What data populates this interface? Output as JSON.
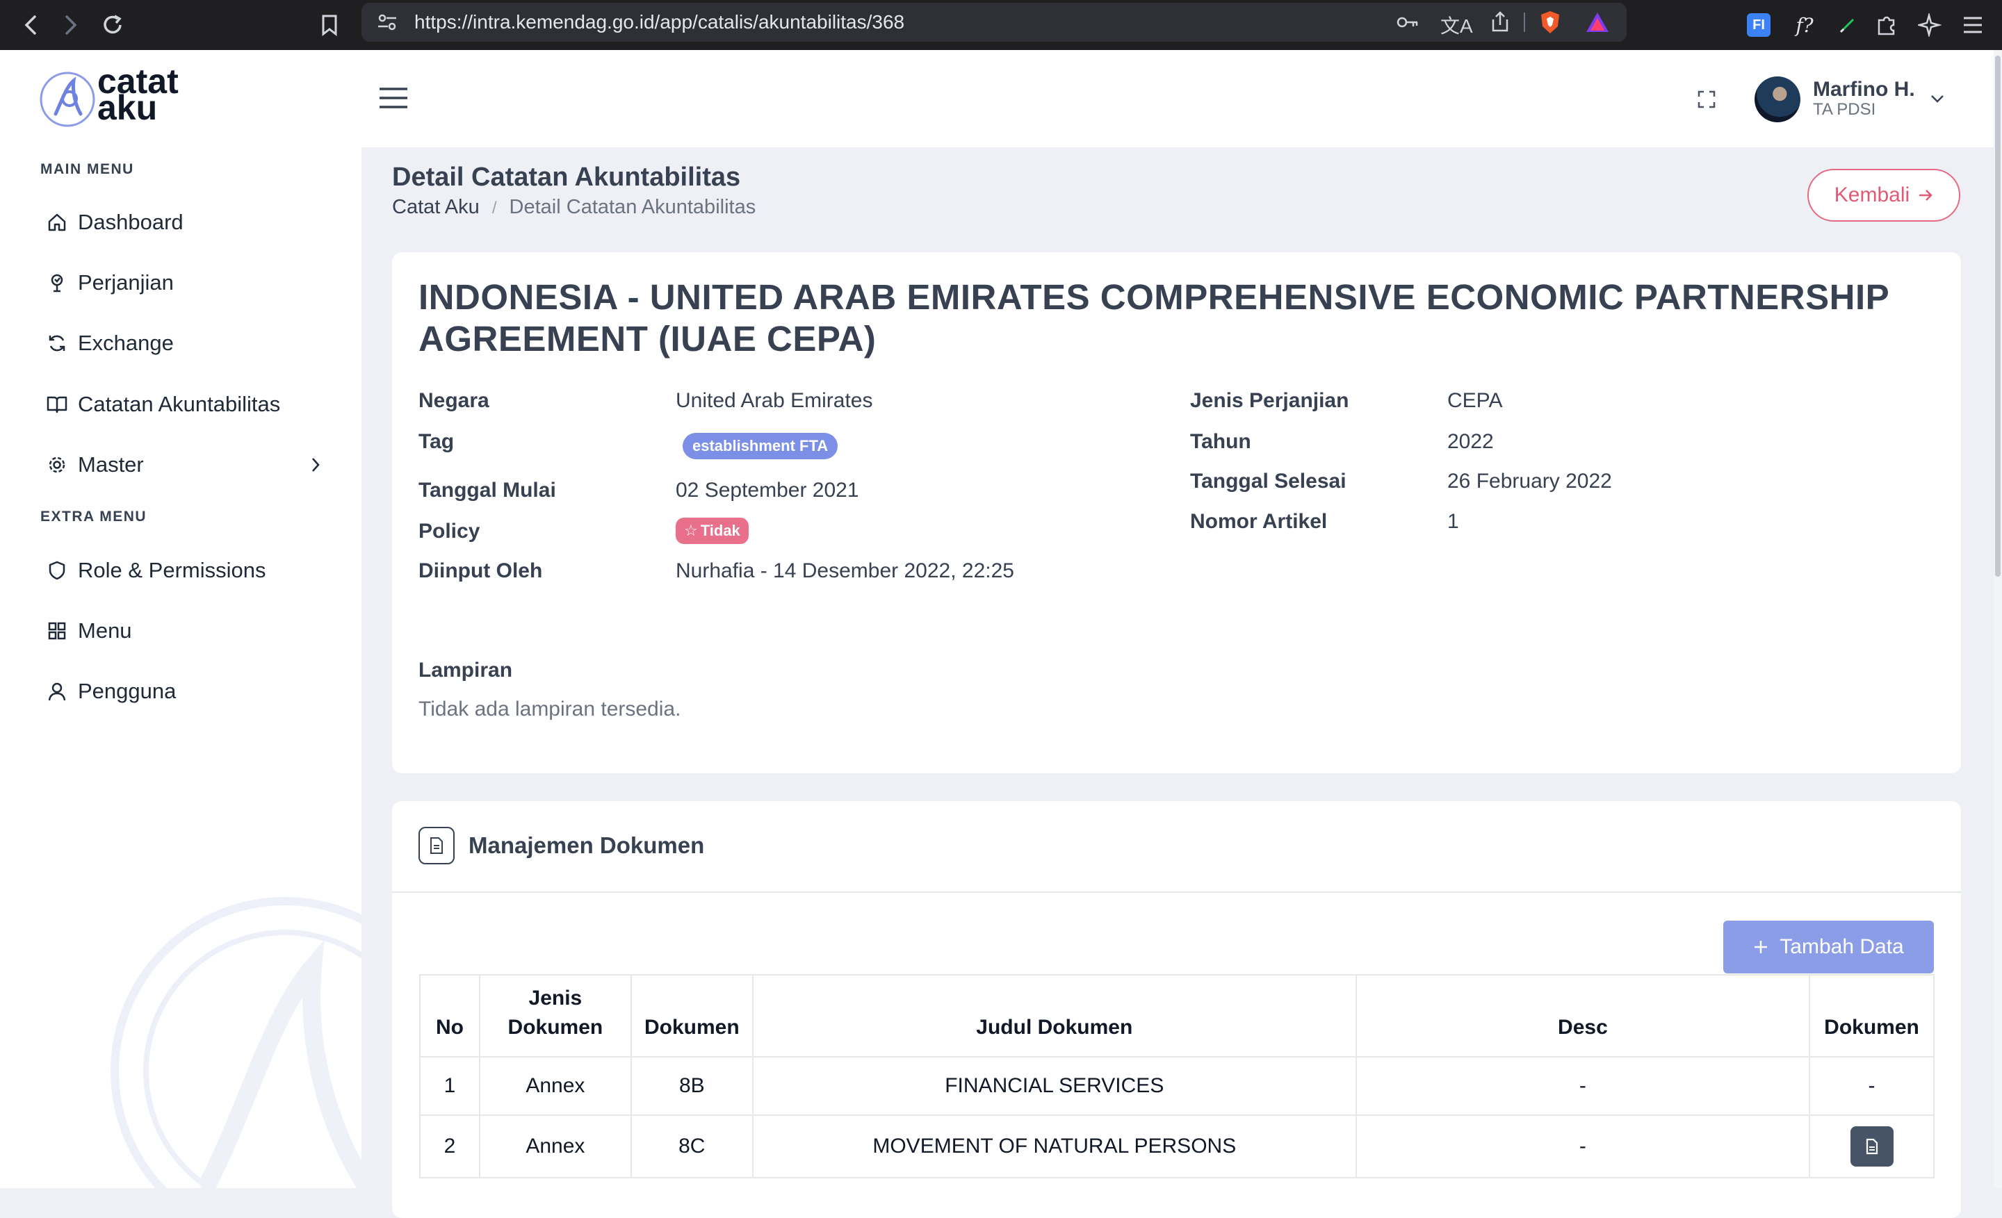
{
  "browser": {
    "url": "https://intra.kemendag.go.id/app/catalis/akuntabilitas/368"
  },
  "app": {
    "logo_line1": "catat",
    "logo_line2": "aku"
  },
  "sidebar": {
    "main_menu_heading": "MAIN MENU",
    "extra_menu_heading": "EXTRA MENU",
    "main_items": [
      {
        "label": "Dashboard",
        "icon": "home-icon"
      },
      {
        "label": "Perjanjian",
        "icon": "agreement-icon"
      },
      {
        "label": "Exchange",
        "icon": "refresh-icon"
      },
      {
        "label": "Catatan Akuntabilitas",
        "icon": "book-icon"
      },
      {
        "label": "Master",
        "icon": "gear-icon"
      }
    ],
    "extra_items": [
      {
        "label": "Role & Permissions",
        "icon": "shield-icon"
      },
      {
        "label": "Menu",
        "icon": "grid-icon"
      },
      {
        "label": "Pengguna",
        "icon": "user-icon"
      }
    ]
  },
  "user": {
    "name": "Marfino H.",
    "role": "TA PDSI"
  },
  "page": {
    "title": "Detail Catatan Akuntabilitas",
    "breadcrumb_home": "Catat Aku",
    "breadcrumb_separator": "/",
    "breadcrumb_current": "Detail Catatan Akuntabilitas",
    "back_button": "Kembali"
  },
  "detail": {
    "heading": "INDONESIA - UNITED ARAB EMIRATES COMPREHENSIVE ECONOMIC PARTNERSHIP AGREEMENT (IUAE CEPA)",
    "labels": {
      "negara": "Negara",
      "tag": "Tag",
      "tanggal_mulai": "Tanggal Mulai",
      "policy": "Policy",
      "diinput_oleh": "Diinput Oleh",
      "jenis_perjanjian": "Jenis Perjanjian",
      "tahun": "Tahun",
      "tanggal_selesai": "Tanggal Selesai",
      "nomor_artikel": "Nomor Artikel",
      "lampiran": "Lampiran"
    },
    "values": {
      "negara": "United Arab Emirates",
      "tag": "establishment FTA",
      "tanggal_mulai": "02 September 2021",
      "policy": "Tidak",
      "diinput_oleh": "Nurhafia - 14 Desember 2022, 22:25",
      "jenis_perjanjian": "CEPA",
      "tahun": "2022",
      "tanggal_selesai": "26 February 2022",
      "nomor_artikel": "1",
      "lampiran": "Tidak ada lampiran tersedia."
    },
    "colors": {
      "tag_badge": "#7b8fe6",
      "policy_badge": "#e8708a"
    }
  },
  "documents": {
    "title": "Manajemen Dokumen",
    "add_button": "Tambah Data",
    "columns": {
      "no": "No",
      "jenis_line1": "Jenis",
      "jenis_line2": "Dokumen",
      "dokumen": "Dokumen",
      "judul": "Judul Dokumen",
      "desc": "Desc",
      "file": "Dokumen"
    },
    "rows": [
      {
        "no": "1",
        "jenis": "Annex",
        "dokumen": "8B",
        "judul": "FINANCIAL SERVICES",
        "desc": "-",
        "file": "-"
      },
      {
        "no": "2",
        "jenis": "Annex",
        "dokumen": "8C",
        "judul": "MOVEMENT OF NATURAL PERSONS",
        "desc": "-",
        "file": "file-icon"
      }
    ]
  }
}
